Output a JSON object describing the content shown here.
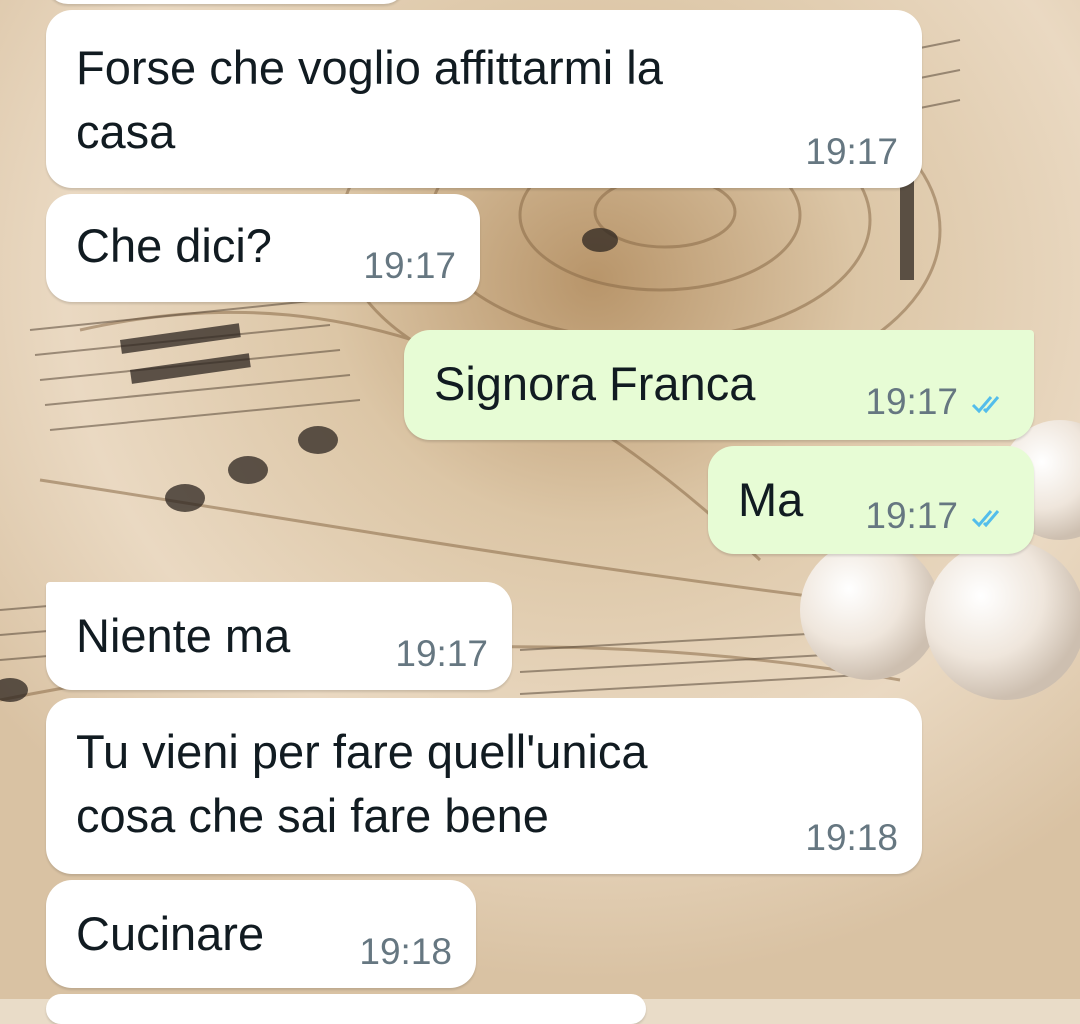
{
  "colors": {
    "incoming_bubble": "#ffffff",
    "outgoing_bubble": "#e7fcd5",
    "timestamp": "#667781",
    "read_ticks": "#53bdeb",
    "wallpaper_paper": "#e9dcc8"
  },
  "wallpaper": {
    "description_icon": "sheet-music-rose-wallpaper"
  },
  "messages": [
    {
      "direction": "in",
      "text_line1": "Forse che voglio affittarmi la",
      "text_line2": "casa",
      "time": "19:17"
    },
    {
      "direction": "in",
      "text": "Che dici?",
      "time": "19:17"
    },
    {
      "direction": "out",
      "text": "Signora Franca",
      "time": "19:17",
      "status": "read"
    },
    {
      "direction": "out",
      "text": "Ma",
      "time": "19:17",
      "status": "read"
    },
    {
      "direction": "in",
      "text": "Niente ma",
      "time": "19:17"
    },
    {
      "direction": "in",
      "text_line1": "Tu vieni per fare quell'unica",
      "text_line2": "cosa che sai fare bene",
      "time": "19:18"
    },
    {
      "direction": "in",
      "text": "Cucinare",
      "time": "19:18"
    }
  ],
  "icons": {
    "read_receipt": "double-check-icon"
  }
}
